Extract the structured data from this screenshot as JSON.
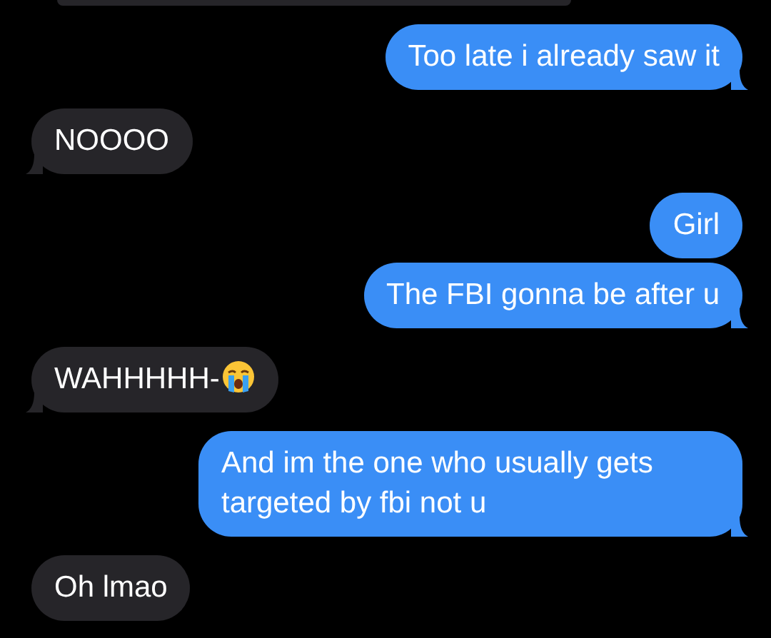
{
  "messages": [
    {
      "kind": "received_cut"
    },
    {
      "kind": "sent",
      "text": "Too late i already saw it",
      "tail": true
    },
    {
      "kind": "received",
      "text": "NOOOO",
      "tail": true
    },
    {
      "kind": "sent",
      "text": "Girl",
      "tail": false
    },
    {
      "kind": "sent",
      "text": "The FBI gonna be after u",
      "tail": true
    },
    {
      "kind": "received",
      "text": "WAHHHHH-",
      "has_emoji": true,
      "tail": true
    },
    {
      "kind": "sent",
      "text": "And im the one who usually gets targeted by fbi not u",
      "tail": true
    },
    {
      "kind": "received",
      "text": "Oh lmao",
      "tail": false
    }
  ]
}
